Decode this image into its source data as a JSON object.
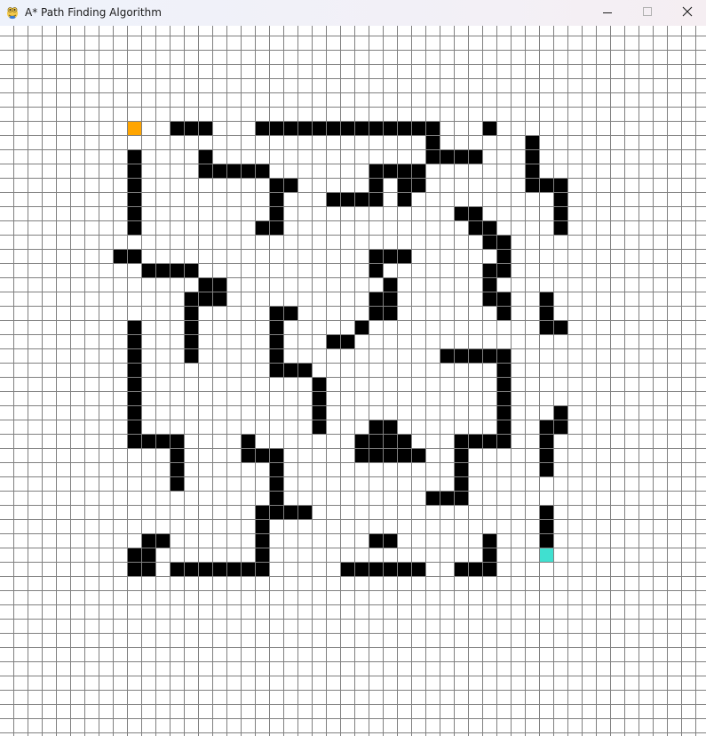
{
  "window": {
    "title": "A* Path Finding Algorithm",
    "app_icon": "pygame-snake-icon"
  },
  "controls": {
    "minimize": "minimize-icon",
    "maximize": "maximize-icon",
    "close": "close-icon"
  },
  "grid": {
    "columns": 50,
    "rows": 50,
    "colors": {
      "background": "#ffffff",
      "grid_line": "#808080",
      "barrier": "#000000",
      "start": "#ffa500",
      "end": "#40e0d0"
    },
    "start": [
      9,
      7
    ],
    "end": [
      38,
      37
    ],
    "barriers": [
      [
        12,
        7
      ],
      [
        13,
        7
      ],
      [
        14,
        7
      ],
      [
        18,
        7
      ],
      [
        19,
        7
      ],
      [
        20,
        7
      ],
      [
        21,
        7
      ],
      [
        22,
        7
      ],
      [
        23,
        7
      ],
      [
        24,
        7
      ],
      [
        25,
        7
      ],
      [
        26,
        7
      ],
      [
        27,
        7
      ],
      [
        28,
        7
      ],
      [
        29,
        7
      ],
      [
        30,
        7
      ],
      [
        34,
        7
      ],
      [
        30,
        8
      ],
      [
        37,
        8
      ],
      [
        9,
        9
      ],
      [
        14,
        9
      ],
      [
        30,
        9
      ],
      [
        31,
        9
      ],
      [
        32,
        9
      ],
      [
        33,
        9
      ],
      [
        37,
        9
      ],
      [
        9,
        10
      ],
      [
        14,
        10
      ],
      [
        15,
        10
      ],
      [
        16,
        10
      ],
      [
        17,
        10
      ],
      [
        18,
        10
      ],
      [
        26,
        10
      ],
      [
        27,
        10
      ],
      [
        28,
        10
      ],
      [
        29,
        10
      ],
      [
        37,
        10
      ],
      [
        9,
        11
      ],
      [
        19,
        11
      ],
      [
        20,
        11
      ],
      [
        26,
        11
      ],
      [
        28,
        11
      ],
      [
        29,
        11
      ],
      [
        37,
        11
      ],
      [
        38,
        11
      ],
      [
        39,
        11
      ],
      [
        9,
        12
      ],
      [
        19,
        12
      ],
      [
        23,
        12
      ],
      [
        24,
        12
      ],
      [
        25,
        12
      ],
      [
        26,
        12
      ],
      [
        28,
        12
      ],
      [
        39,
        12
      ],
      [
        9,
        13
      ],
      [
        19,
        13
      ],
      [
        32,
        13
      ],
      [
        33,
        13
      ],
      [
        39,
        13
      ],
      [
        9,
        14
      ],
      [
        18,
        14
      ],
      [
        19,
        14
      ],
      [
        33,
        14
      ],
      [
        34,
        14
      ],
      [
        39,
        14
      ],
      [
        34,
        15
      ],
      [
        35,
        15
      ],
      [
        8,
        16
      ],
      [
        9,
        16
      ],
      [
        26,
        16
      ],
      [
        27,
        16
      ],
      [
        28,
        16
      ],
      [
        35,
        16
      ],
      [
        10,
        17
      ],
      [
        11,
        17
      ],
      [
        12,
        17
      ],
      [
        13,
        17
      ],
      [
        26,
        17
      ],
      [
        34,
        17
      ],
      [
        35,
        17
      ],
      [
        14,
        18
      ],
      [
        15,
        18
      ],
      [
        27,
        18
      ],
      [
        34,
        18
      ],
      [
        13,
        19
      ],
      [
        14,
        19
      ],
      [
        15,
        19
      ],
      [
        26,
        19
      ],
      [
        27,
        19
      ],
      [
        34,
        19
      ],
      [
        35,
        19
      ],
      [
        38,
        19
      ],
      [
        13,
        20
      ],
      [
        19,
        20
      ],
      [
        20,
        20
      ],
      [
        26,
        20
      ],
      [
        27,
        20
      ],
      [
        35,
        20
      ],
      [
        38,
        20
      ],
      [
        9,
        21
      ],
      [
        13,
        21
      ],
      [
        19,
        21
      ],
      [
        25,
        21
      ],
      [
        38,
        21
      ],
      [
        39,
        21
      ],
      [
        9,
        22
      ],
      [
        13,
        22
      ],
      [
        19,
        22
      ],
      [
        23,
        22
      ],
      [
        24,
        22
      ],
      [
        9,
        23
      ],
      [
        13,
        23
      ],
      [
        19,
        23
      ],
      [
        31,
        23
      ],
      [
        32,
        23
      ],
      [
        33,
        23
      ],
      [
        34,
        23
      ],
      [
        35,
        23
      ],
      [
        9,
        24
      ],
      [
        19,
        24
      ],
      [
        20,
        24
      ],
      [
        21,
        24
      ],
      [
        35,
        24
      ],
      [
        9,
        25
      ],
      [
        22,
        25
      ],
      [
        35,
        25
      ],
      [
        9,
        26
      ],
      [
        22,
        26
      ],
      [
        35,
        26
      ],
      [
        9,
        27
      ],
      [
        22,
        27
      ],
      [
        35,
        27
      ],
      [
        39,
        27
      ],
      [
        9,
        28
      ],
      [
        22,
        28
      ],
      [
        26,
        28
      ],
      [
        27,
        28
      ],
      [
        35,
        28
      ],
      [
        38,
        28
      ],
      [
        39,
        28
      ],
      [
        9,
        29
      ],
      [
        10,
        29
      ],
      [
        11,
        29
      ],
      [
        12,
        29
      ],
      [
        17,
        29
      ],
      [
        25,
        29
      ],
      [
        26,
        29
      ],
      [
        27,
        29
      ],
      [
        28,
        29
      ],
      [
        32,
        29
      ],
      [
        33,
        29
      ],
      [
        34,
        29
      ],
      [
        35,
        29
      ],
      [
        38,
        29
      ],
      [
        12,
        30
      ],
      [
        17,
        30
      ],
      [
        18,
        30
      ],
      [
        19,
        30
      ],
      [
        25,
        30
      ],
      [
        26,
        30
      ],
      [
        27,
        30
      ],
      [
        28,
        30
      ],
      [
        29,
        30
      ],
      [
        32,
        30
      ],
      [
        38,
        30
      ],
      [
        12,
        31
      ],
      [
        19,
        31
      ],
      [
        32,
        31
      ],
      [
        38,
        31
      ],
      [
        12,
        32
      ],
      [
        19,
        32
      ],
      [
        32,
        32
      ],
      [
        19,
        33
      ],
      [
        30,
        33
      ],
      [
        31,
        33
      ],
      [
        32,
        33
      ],
      [
        18,
        34
      ],
      [
        19,
        34
      ],
      [
        20,
        34
      ],
      [
        21,
        34
      ],
      [
        38,
        34
      ],
      [
        18,
        35
      ],
      [
        38,
        35
      ],
      [
        10,
        36
      ],
      [
        11,
        36
      ],
      [
        18,
        36
      ],
      [
        26,
        36
      ],
      [
        27,
        36
      ],
      [
        34,
        36
      ],
      [
        38,
        36
      ],
      [
        9,
        37
      ],
      [
        10,
        37
      ],
      [
        18,
        37
      ],
      [
        34,
        37
      ],
      [
        38,
        37
      ],
      [
        9,
        38
      ],
      [
        10,
        38
      ],
      [
        12,
        38
      ],
      [
        13,
        38
      ],
      [
        14,
        38
      ],
      [
        15,
        38
      ],
      [
        16,
        38
      ],
      [
        17,
        38
      ],
      [
        18,
        38
      ],
      [
        24,
        38
      ],
      [
        25,
        38
      ],
      [
        26,
        38
      ],
      [
        27,
        38
      ],
      [
        28,
        38
      ],
      [
        29,
        38
      ],
      [
        32,
        38
      ],
      [
        33,
        38
      ],
      [
        34,
        38
      ]
    ]
  }
}
